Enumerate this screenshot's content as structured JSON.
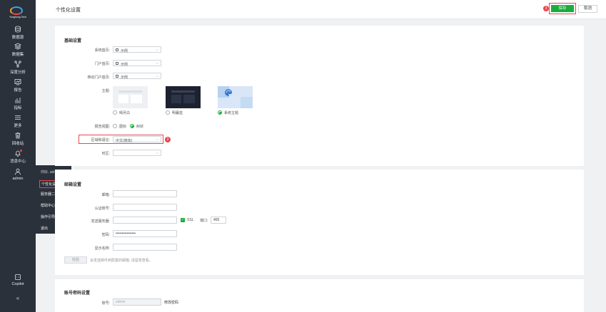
{
  "sidebar": {
    "logo_text": "Yonghong Tech",
    "items": [
      {
        "label": "数据源",
        "icon": "database-icon"
      },
      {
        "label": "数据集",
        "icon": "dataset-icon"
      },
      {
        "label": "深度分析",
        "icon": "analysis-icon"
      },
      {
        "label": "报告",
        "icon": "report-icon"
      },
      {
        "label": "指标",
        "icon": "metric-icon"
      },
      {
        "label": "更多",
        "icon": "menu-icon"
      },
      {
        "label": "回收站",
        "icon": "trash-icon"
      },
      {
        "label": "消息中心",
        "icon": "bell-icon"
      },
      {
        "label": "admin",
        "icon": "user-icon"
      }
    ],
    "copilot_label": "Copilot",
    "collapse_icon": "«"
  },
  "user_menu": {
    "greeting": "你好, admin",
    "items": [
      "个性化设置",
      "服务器二维码",
      "帮助中心",
      "操作引导",
      "退出"
    ]
  },
  "header": {
    "title": "个性化设置",
    "save_label": "保存",
    "cancel_label": "取消"
  },
  "steps": {
    "s1": "1",
    "s2": "2",
    "s3": "3"
  },
  "basic": {
    "title": "基础设置",
    "system_home_label": "系统首页:",
    "system_home_value": "示例",
    "portal_home_label": "门户首页:",
    "portal_home_value": "示例",
    "mobile_home_label": "移动门户首页:",
    "mobile_home_value": "示例",
    "theme_label": "主题:",
    "themes": [
      "晴月白",
      "明暮蓝",
      "系统主题"
    ],
    "report_view_label": "报告视图:",
    "report_views": [
      "图标",
      "树状"
    ],
    "locale_label": "区域和语言:",
    "locale_value": "中文(简体)",
    "timezone_label": "时区:",
    "timezone_value": ""
  },
  "mail": {
    "title": "邮箱设置",
    "email_label": "邮箱:",
    "auth_label": "认证账号:",
    "server_label": "发送服务器:",
    "ssl_label": "SSL",
    "port_label": "端口:",
    "port_value": "465",
    "password_label": "密码:",
    "password_value": "••••••••••••••••",
    "display_label": "显示名称:",
    "test_label": "检验",
    "hint": "会发送邮件到配置的邮箱, 请留意查看。"
  },
  "account": {
    "title": "账号密码设置",
    "account_label": "账号:",
    "account_value": "admin",
    "change_password": "修改密码"
  }
}
